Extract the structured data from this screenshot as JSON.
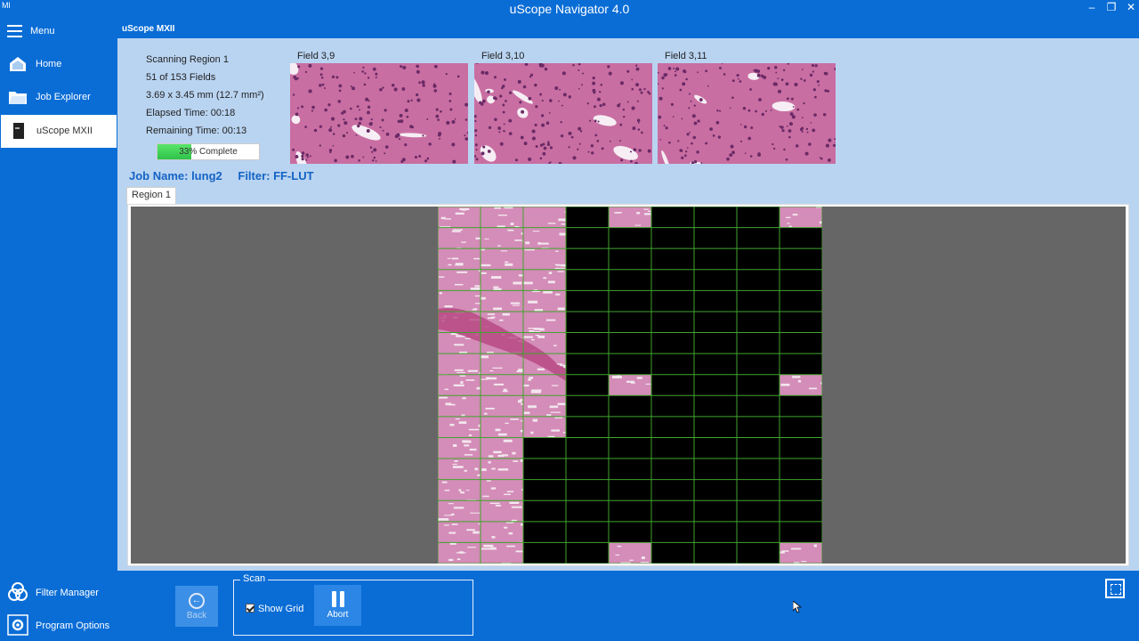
{
  "window": {
    "icon_text": "Ml",
    "title": "uScope Navigator 4.0",
    "controls": [
      "minimize",
      "restore",
      "close"
    ]
  },
  "sidebar": {
    "menu_label": "Menu",
    "items": [
      {
        "label": "Home",
        "icon": "home-icon"
      },
      {
        "label": "Job Explorer",
        "icon": "folder-icon"
      },
      {
        "label": "uScope MXII",
        "icon": "device-icon",
        "active": true
      }
    ],
    "bottom_items": [
      {
        "label": "Filter Manager",
        "icon": "filter-icon"
      },
      {
        "label": "Program Options",
        "icon": "gear-icon"
      }
    ]
  },
  "header": {
    "device_name": "uScope MXII"
  },
  "status": {
    "line1": "Scanning Region 1",
    "line2": "51 of 153 Fields",
    "line3": "3.69 x 3.45 mm (12.7 mm²)",
    "line4": "Elapsed Time: 00:18",
    "line5": "Remaining Time: 00:13",
    "progress_text": "33% Complete",
    "progress_fraction": 0.33
  },
  "fields": [
    {
      "label": "Field 3,9"
    },
    {
      "label": "Field 3,10"
    },
    {
      "label": "Field 3,11"
    }
  ],
  "job": {
    "name_text": "Job Name: lung2",
    "filter_text": "Filter: FF-LUT"
  },
  "region_tab": "Region 1",
  "scan_grid": {
    "columns": 9,
    "rows": 17,
    "grid_visible": true,
    "colors": {
      "background": "#666666",
      "unscanned": "#000000",
      "grid_line": "#3fa52d",
      "tissue": "#d48cb8"
    }
  },
  "bottom": {
    "back_label": "Back",
    "scan_group_label": "Scan",
    "show_grid_label": "Show Grid",
    "show_grid_checked": true,
    "abort_label": "Abort"
  },
  "colors": {
    "accent": "#0a6dd6",
    "pane": "#b9d4f1",
    "progress": "#3fd35a"
  }
}
